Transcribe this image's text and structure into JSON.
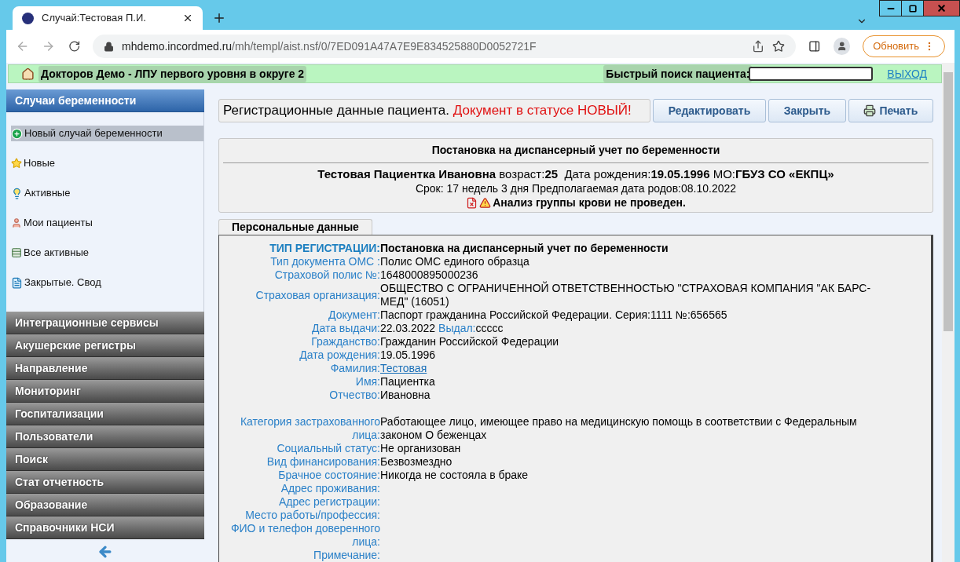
{
  "browser": {
    "tab_title": "Случай:Тестовая П.И.",
    "url_host": "mhdemo.incordmed.ru",
    "url_path": "/mh/templ/aist.nsf/0/7ED091A47A7E9E834525880D0052721F",
    "update_button": "Обновить"
  },
  "header": {
    "org": "Докторов Демо - ЛПУ первого уровня в округе 2",
    "search_label": "Быстрый поиск пациента:",
    "logout": "ВЫХОД"
  },
  "sidebar": {
    "sections": [
      {
        "title": "Случаи беременности",
        "expanded": true,
        "items": [
          {
            "label": "Новый случай беременности",
            "selected": true
          },
          {
            "label": "Новые",
            "selected": false
          },
          {
            "label": "Активные",
            "selected": false
          },
          {
            "label": "Мои пациенты",
            "selected": false
          },
          {
            "label": "Все активные",
            "selected": false
          },
          {
            "label": "Закрытые. Свод",
            "selected": false
          }
        ]
      },
      {
        "title": "Интеграционные сервисы",
        "expanded": false
      },
      {
        "title": "Акушерские регистры",
        "expanded": false
      },
      {
        "title": "Направление",
        "expanded": false
      },
      {
        "title": "Мониторинг",
        "expanded": false
      },
      {
        "title": "Госпитализации",
        "expanded": false
      },
      {
        "title": "Пользователи",
        "expanded": false
      },
      {
        "title": "Поиск",
        "expanded": false
      },
      {
        "title": "Стат отчетность",
        "expanded": false
      },
      {
        "title": "Образование",
        "expanded": false
      },
      {
        "title": "Справочники НСИ",
        "expanded": false
      }
    ]
  },
  "main": {
    "title": "Регистрационные данные пациента.",
    "status": "Документ в статусе НОВЫЙ!",
    "buttons": [
      {
        "label": "Редактировать"
      },
      {
        "label": "Закрыть"
      },
      {
        "label": "Печать"
      }
    ],
    "summary": {
      "heading": "Постановка на диспансерный учет по беременности",
      "patient_name": "Тестовая Пациентка Ивановна",
      "age_label": "возраст:",
      "age": "25",
      "birth_label": "Дата рождения:",
      "birth": "19.05.1996",
      "mo_label": "МО:",
      "mo": "ГБУЗ СО «ЕКПЦ»",
      "term": "Срок: 17 недель 3 дня Предполагаемая дата родов:08.10.2022",
      "warning": "Анализ группы крови не проведен."
    },
    "tabs": [
      {
        "label": "Персональные данные",
        "selected": true
      }
    ],
    "field_groups": [
      {
        "fields": [
          {
            "label": "ТИП РЕГИСТРАЦИИ:",
            "value": "Постановка на диспансерный учет по беременности",
            "kind": "emphasis"
          },
          {
            "label": "Тип документа ОМС :",
            "value": "Полис ОМС единого образца",
            "kind": "text"
          },
          {
            "label": "Страховой полис №:",
            "value": "1648000895000236",
            "kind": "text"
          },
          {
            "label": "Страховая организация:",
            "value": "ОБЩЕСТВО С ОГРАНИЧЕННОЙ ОТВЕТСТВЕННОСТЬЮ \"СТРАХОВАЯ КОМПАНИЯ \"АК БАРС-МЕД\" (16051)",
            "kind": "text"
          },
          {
            "label": "Документ:",
            "value": "Паспорт гражданина Российской Федерации. Серия:1111 №:656565",
            "kind": "text"
          },
          {
            "label": "Дата выдачи:",
            "value": "22.03.2022",
            "kind": "text",
            "extra_label": "Выдал:",
            "extra_value": "ccccc"
          },
          {
            "label": "Гражданство:",
            "value": "Гражданин Российской Федерации",
            "kind": "text"
          },
          {
            "label": "Дата рождения:",
            "value": "19.05.1996",
            "kind": "text"
          },
          {
            "label": "Фамилия:",
            "value": "Тестовая",
            "kind": "link"
          },
          {
            "label": "Имя:",
            "value": "Пациентка",
            "kind": "text"
          },
          {
            "label": "Отчество:",
            "value": "Ивановна",
            "kind": "text"
          }
        ]
      },
      {
        "fields": [
          {
            "label": "Категория застрахованного лица:",
            "value": "Работающее лицо, имеющее право на медицинскую помощь в соответствии с Федеральным законом О беженцах",
            "kind": "text"
          },
          {
            "label": "Социальный статус:",
            "value": "Не организован",
            "kind": "text"
          },
          {
            "label": "Вид финансирования:",
            "value": "Безвозмездно",
            "kind": "text"
          },
          {
            "label": "Брачное состояние:",
            "value": "Никогда не состояла в браке",
            "kind": "text"
          },
          {
            "label": "Адрес проживания:",
            "kind": "text"
          },
          {
            "label": "Адрес регистрации:",
            "kind": "text"
          },
          {
            "label": "Место работы/профессия:",
            "kind": "text"
          },
          {
            "label": "ФИО и телефон доверенного лица:",
            "kind": "text"
          },
          {
            "label": "Примечание:",
            "kind": "text"
          }
        ]
      }
    ]
  }
}
